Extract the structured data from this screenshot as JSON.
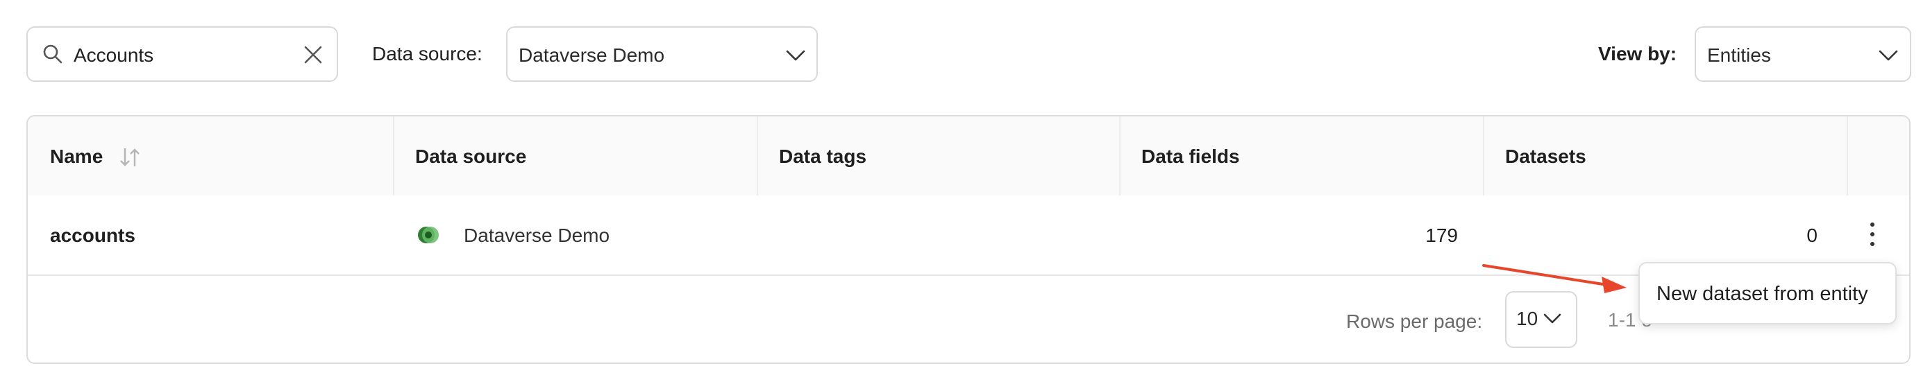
{
  "search": {
    "value": "Accounts",
    "icon": "search-icon",
    "clear_icon": "close-icon"
  },
  "filters": {
    "data_source_label": "Data source:",
    "data_source_value": "Dataverse Demo",
    "view_by_label": "View by:",
    "view_by_value": "Entities"
  },
  "table": {
    "columns": [
      "Name",
      "Data source",
      "Data tags",
      "Data fields",
      "Datasets"
    ],
    "rows": [
      {
        "name": "accounts",
        "data_source": "Dataverse Demo",
        "data_tags": "",
        "data_fields": "179",
        "datasets": "0"
      }
    ]
  },
  "pagination": {
    "rows_per_page_label": "Rows per page:",
    "rows_per_page_value": "10",
    "range_text": "1-1 o"
  },
  "menu": {
    "items": [
      "New dataset from entity"
    ]
  },
  "colors": {
    "annotation_arrow": "#e8462a",
    "dataverse_green": "#2e7d32"
  }
}
